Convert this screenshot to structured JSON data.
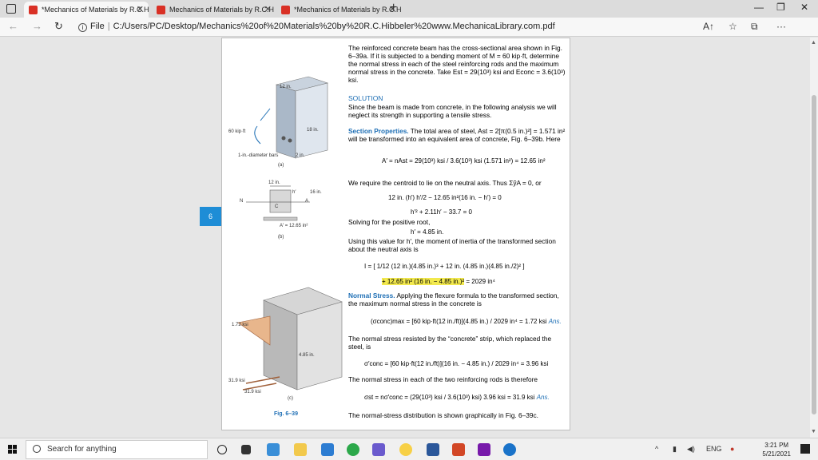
{
  "browser": {
    "tabs": [
      {
        "title": "*Mechanics of Materials by R.C.H",
        "active": true
      },
      {
        "title": "Mechanics of Materials by R.C.H",
        "active": false
      },
      {
        "title": "*Mechanics of Materials by R.C.H",
        "active": false
      }
    ],
    "url_prefix": "File",
    "url": "C:/Users/PC/Desktop/Mechanics%20of%20Materials%20by%20R.C.Hibbeler%20www.MechanicaLibrary.com.pdf"
  },
  "viewer": {
    "page_badge": "6"
  },
  "figure": {
    "a": {
      "label": "(a)",
      "moment": "60 kip·ft",
      "width": "12 in.",
      "depth": "18 in.",
      "bars": "1-in.-diameter bars",
      "cover": "2 in."
    },
    "b": {
      "label": "(b)",
      "width": "12 in.",
      "h": "h′",
      "d": "16 in.",
      "N": "N",
      "C": "C",
      "A": "A",
      "area": "A′ = 12.65 in²"
    },
    "c": {
      "label": "(c)",
      "s1": "1.72 ksi",
      "hprime": "4.85 in.",
      "s2": "31.9 ksi",
      "s3": "31.9 ksi"
    },
    "caption": "Fig. 6–39"
  },
  "text": {
    "intro": "The reinforced concrete beam has the cross-sectional area shown in Fig. 6–39a. If it is subjected to a bending moment of M = 60 kip·ft, determine the normal stress in each of the steel reinforcing rods and the maximum normal stress in the concrete. Take Est = 29(10³) ksi and Econc = 3.6(10³) ksi.",
    "solution_title": "SOLUTION",
    "solution_body": "Since the beam is made from concrete, in the following analysis we will neglect its strength in supporting a tensile stress.",
    "section_title": "Section Properties.",
    "section_body": "The total area of steel, Ast = 2[π(0.5 in.)²] = 1.571 in² will be transformed into an equivalent area of concrete, Fig. 6–39b. Here",
    "eq1": "A′ = nAst = 29(10³) ksi / 3.6(10³) ksi (1.571 in²) = 12.65 in²",
    "centroid": "We require the centroid to lie on the neutral axis. Thus ΣỹA = 0, or",
    "eq2": "12 in. (h′) h′/2 − 12.65 in²(16 in. − h′) = 0",
    "eq3": "h′² + 2.11h′ − 33.7 = 0",
    "solving": "Solving for the positive root,",
    "eq4": "h′ = 4.85 in.",
    "using": "Using this value for h′, the moment of inertia of the transformed section about the neutral axis is",
    "eq5a": "I = [ 1/12 (12 in.)(4.85 in.)³ + 12 in. (4.85 in.)(4.85 in./2)² ]",
    "eq5b_hl": "+ 12.65 in² (16 in. − 4.85 in.)²",
    "eq5c": "= 2029 in⁴",
    "normal_title": "Normal Stress.",
    "normal_body": "Applying the flexure formula to the transformed section, the maximum normal stress in the concrete is",
    "eq6": "(σconc)max = [60 kip·ft(12 in./ft)](4.85 in.) / 2029 in⁴ = 1.72 ksi",
    "ans": "Ans.",
    "strip": "The normal stress resisted by the “concrete” strip, which replaced the steel, is",
    "eq7": "σ′conc = [60 kip·ft(12 in./ft)](16 in. − 4.85 in.) / 2029 in⁴ = 3.96 ksi",
    "rods": "The normal stress in each of the two reinforcing rods is therefore",
    "eq8": "σst = nσ′conc = (29(10³) ksi / 3.6(10³) ksi) 3.96 ksi = 31.9 ksi",
    "final": "The normal-stress distribution is shown graphically in Fig. 6–39c."
  },
  "taskbar": {
    "search_placeholder": "Search for anything",
    "time": "3:21 PM",
    "date": "5/21/2021"
  }
}
